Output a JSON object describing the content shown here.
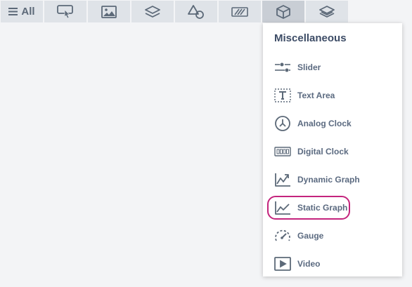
{
  "tabs": {
    "all_label": "All",
    "items": [
      {
        "name": "interactions",
        "icon": "pointer-hand-icon"
      },
      {
        "name": "images",
        "icon": "image-icon"
      },
      {
        "name": "layers",
        "icon": "layers-icon"
      },
      {
        "name": "shapes",
        "icon": "shapes-icon"
      },
      {
        "name": "patterns",
        "icon": "hatch-icon"
      },
      {
        "name": "miscellaneous",
        "icon": "cube-icon",
        "active": true
      },
      {
        "name": "stacks",
        "icon": "stack-icon"
      }
    ]
  },
  "dropdown": {
    "title": "Miscellaneous",
    "items": [
      {
        "label": "Slider",
        "icon": "slider-icon"
      },
      {
        "label": "Text Area",
        "icon": "text-area-icon"
      },
      {
        "label": "Analog Clock",
        "icon": "analog-clock-icon"
      },
      {
        "label": "Digital Clock",
        "icon": "digital-clock-icon"
      },
      {
        "label": "Dynamic Graph",
        "icon": "dynamic-graph-icon"
      },
      {
        "label": "Static Graph",
        "icon": "static-graph-icon",
        "highlighted": true
      },
      {
        "label": "Gauge",
        "icon": "gauge-icon"
      },
      {
        "label": "Video",
        "icon": "video-icon"
      }
    ]
  },
  "colors": {
    "tab_bg": "#dfe3e8",
    "tab_active_bg": "#c9ced5",
    "icon_color": "#5c6978",
    "highlight": "#c4247d",
    "title": "#3d4c66"
  }
}
